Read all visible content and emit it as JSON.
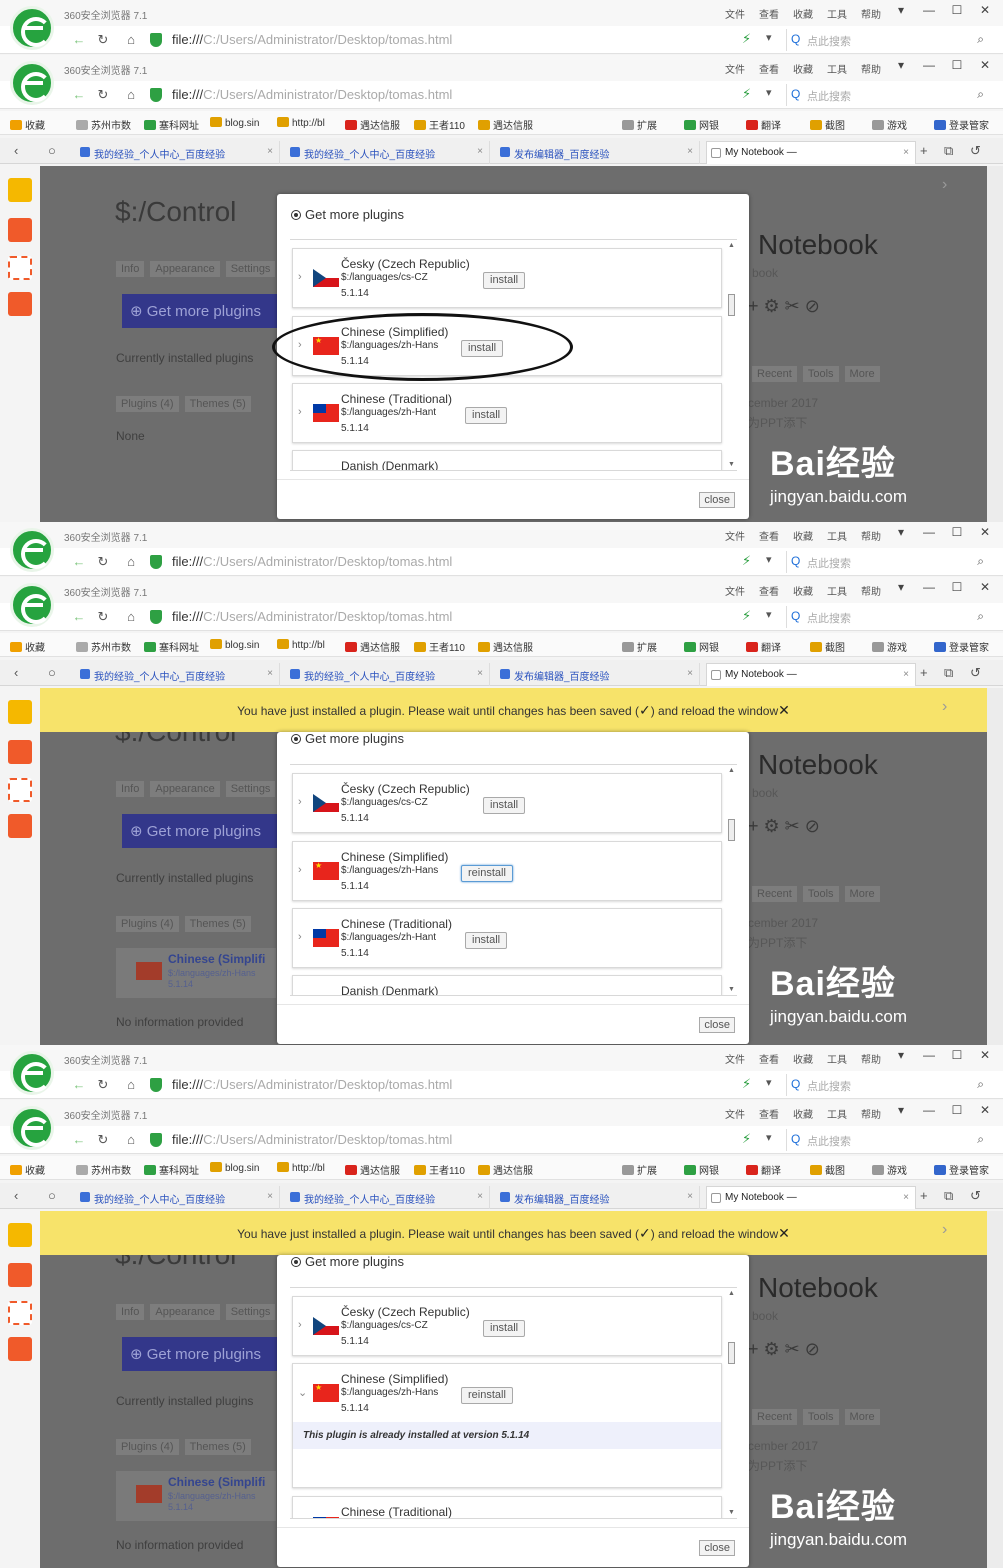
{
  "browser": {
    "app_title": "360安全浏览器 7.1",
    "menus": [
      "文件",
      "查看",
      "收藏",
      "工具",
      "帮助"
    ],
    "url_scheme": "file:///",
    "url_path": "C:/Users/Administrator/Desktop/tomas.html",
    "search_placeholder": "点此搜索",
    "favorites": [
      "收藏",
      "苏州市数",
      "塞科网址",
      "blog.sin",
      "http://bl",
      "遇达信服",
      "王者110",
      "遇达信服",
      "扩展",
      "网银",
      "翻译",
      "截图",
      "游戏",
      "登录管家"
    ],
    "tabs": [
      "我的经验_个人中心_百度经验",
      "我的经验_个人中心_百度经验",
      "发布编辑器_百度经验",
      "My Notebook —"
    ]
  },
  "page": {
    "title": "$:/Control",
    "tabs": [
      "Info",
      "Appearance",
      "Settings"
    ],
    "get_more_button": "Get more plugins",
    "installed_label": "Currently installed plugins",
    "subtabs": [
      "Plugins (4)",
      "Themes (5)"
    ],
    "none_text": "None",
    "no_info_text": "No information provided",
    "notebook_title": "Notebook",
    "notebook_sub": "book",
    "nb_tabs": [
      "Recent",
      "Tools",
      "More"
    ],
    "nb_date": "cember 2017",
    "nb_item": "为PPT添下"
  },
  "installed_plugin": {
    "name": "Chinese (Simplifi",
    "path": "$:/languages/zh-Hans",
    "version": "5.1.14"
  },
  "modal": {
    "header": "Get more plugins",
    "close_label": "close",
    "already_installed": "This plugin is already installed at version 5.1.14",
    "plugins": [
      {
        "name": "Česky (Czech Republic)",
        "path": "$:/languages/cs-CZ",
        "version": "5.1.14",
        "action": "install"
      },
      {
        "name": "Chinese (Simplified)",
        "path": "$:/languages/zh-Hans",
        "version": "5.1.14",
        "action": "install",
        "action_after": "reinstall"
      },
      {
        "name": "Chinese (Traditional)",
        "path": "$:/languages/zh-Hant",
        "version": "5.1.14",
        "action": "install"
      },
      {
        "name": "Danish (Denmark)"
      }
    ]
  },
  "notification": {
    "before": "You have just installed a plugin. Please wait until changes has been saved (",
    "check": "✓",
    "after": ") and reload the window",
    "close": "✕"
  },
  "watermark": {
    "brand": "Bai经验",
    "domain": "jingyan.baidu.com"
  },
  "colors": {
    "accent_green": "#26a33f",
    "notify_yellow": "#f7e36a",
    "dim_overlay": "#6d6d6d",
    "plugin_btn": "#33378a"
  }
}
